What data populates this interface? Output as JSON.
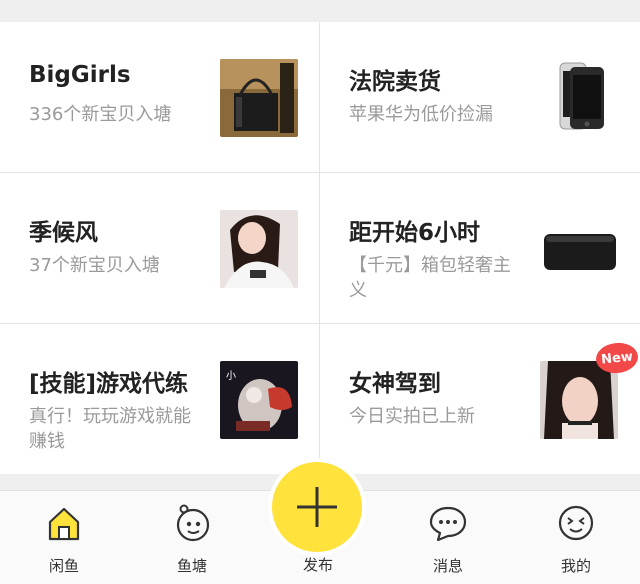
{
  "cards": [
    {
      "title": "BigGirls",
      "subtitle": "336个新宝贝入塘",
      "thumb": "handbag-photo"
    },
    {
      "title": "法院卖货",
      "subtitle": "苹果华为低价捡漏",
      "thumb": "phone-photo"
    },
    {
      "title": "季候风",
      "subtitle": "37个新宝贝入塘",
      "thumb": "girl-photo"
    },
    {
      "title": "距开始6小时",
      "subtitle": "【千元】箱包轻奢主义",
      "thumb": "wallet-photo"
    },
    {
      "title": "[技能]游戏代练",
      "subtitle": "真行！玩玩游戏就能赚钱",
      "thumb": "game-photo"
    },
    {
      "title": "女神驾到",
      "subtitle": "今日实拍已上新",
      "thumb": "selfie-photo",
      "badge": "New"
    }
  ],
  "tabbar": {
    "home_label": "闲鱼",
    "pond_label": "鱼塘",
    "publish_label": "发布",
    "messages_label": "消息",
    "me_label": "我的"
  },
  "colors": {
    "accent": "#ffe23c",
    "badge": "#f24848",
    "title_text": "#222222",
    "subtitle_text": "#9a9a9a"
  }
}
